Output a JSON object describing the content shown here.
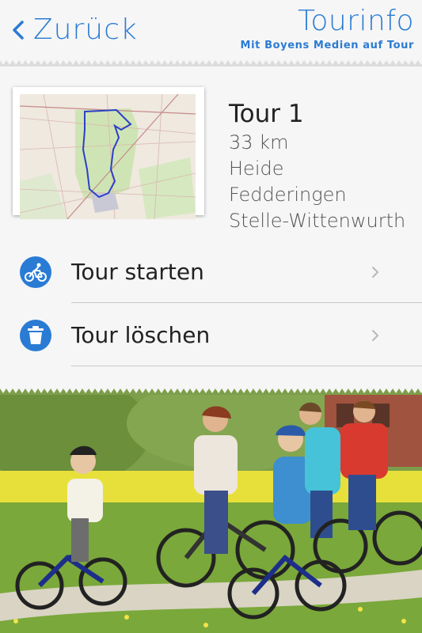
{
  "header": {
    "back_label": "Zurück",
    "title": "Tourinfo",
    "subtitle": "Mit Boyens Medien auf Tour"
  },
  "tour": {
    "name": "Tour 1",
    "distance": "33 km",
    "stops": [
      "Heide",
      "Fedderingen",
      "Stelle-Wittenwurth"
    ]
  },
  "actions": {
    "start": {
      "label": "Tour starten",
      "icon": "bicycle-icon"
    },
    "delete": {
      "label": "Tour löschen",
      "icon": "trash-icon"
    }
  },
  "colors": {
    "accent": "#2a7bd4",
    "background": "#f6f6f6",
    "divider": "#c8c8c8"
  }
}
